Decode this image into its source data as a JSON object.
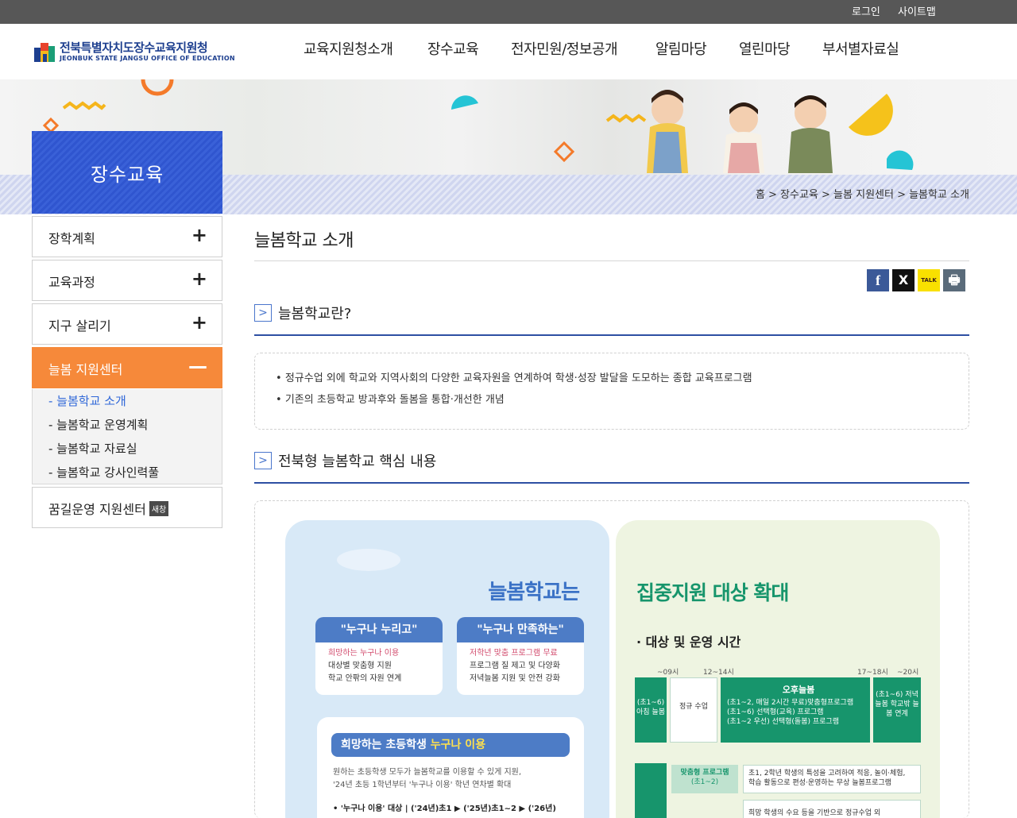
{
  "util": {
    "login": "로그인",
    "sitemap": "사이트맵"
  },
  "logo": {
    "ko": "전북특별자치도장수교육지원청",
    "en": "JEONBUK STATE JANGSU OFFICE OF EDUCATION"
  },
  "gnb": [
    "교육지원청소개",
    "장수교육",
    "전자민원/정보공개",
    "알림마당",
    "열린마당",
    "부서별자료실"
  ],
  "breadcrumb": "홈 > 장수교육 > 늘봄 지원센터 > 늘봄학교 소개",
  "sidebar": {
    "title": "장수교육",
    "items": [
      {
        "label": "장학계획",
        "toggle": "+"
      },
      {
        "label": "교육과정",
        "toggle": "+"
      },
      {
        "label": "지구 살리기",
        "toggle": "+"
      },
      {
        "label": "늘봄 지원센터",
        "toggle": "—"
      },
      {
        "label": "꿈길운영 지원센터",
        "badge": "새창"
      }
    ],
    "sub": [
      "- 늘봄학교 소개",
      "- 늘봄학교 운영계획",
      "- 늘봄학교 자료실",
      "- 늘봄학교 강사인력풀"
    ]
  },
  "page": {
    "title": "늘봄학교 소개"
  },
  "share": {
    "facebook": "f",
    "x": "X",
    "kakao": "TALK",
    "print": "🖶"
  },
  "sections": [
    {
      "title": "늘봄학교란?",
      "items": [
        "정규수업 외에 학교와 지역사회의 다양한 교육자원을 연계하여 학생·성장 발달을 도모하는 종합 교육프로그램",
        "기존의 초등학교 방과후와 돌봄을 통합·개선한 개념"
      ]
    },
    {
      "title": "전북형 늘봄학교 핵심 내용"
    }
  ],
  "infographic": {
    "left_title": "늘봄학교는",
    "card1": {
      "title": "\"누구나 누리고\"",
      "l1": "희망하는 누구나 이용",
      "l2": "대상별 맞춤형 지원",
      "l3": "학교 안팎의 자원 연계"
    },
    "card2": {
      "title": "\"누구나 만족하는\"",
      "l1": "저학년 맞춤 프로그램 무료",
      "l2": "프로그램 질 제고 및 다양화",
      "l3": "저녁늘봄 지원 및 안전 강화"
    },
    "wide": {
      "bar_a": "희망하는 초등학생 ",
      "bar_b": "누구나 이용",
      "t1": "원하는 초등학생 모두가 늘봄학교를 이용할 수 있게 지원,",
      "t2": "'24년 초등 1학년부터 '누구나 이용' 학년 연차별 확대",
      "t3": "• '누구나 이용' 대상 | ('24년)초1 ▶ ('25년)초1~2 ▶ ('26년)"
    },
    "right_title": "집중지원 대상 확대",
    "right_sub": "· 대상 및 운영 시간",
    "times": [
      "~09시",
      "12~14시",
      "17~18시",
      "~20시"
    ],
    "morning": "(초1~6) 아침 늘봄",
    "regular": "정규 수업",
    "afternoon": {
      "title": "오후늘봄",
      "l1": "(초1~2, 매일 2시간 무료)맞춤형프로그램",
      "l2": "(초1~6) 선택형(교육) 프로그램",
      "l3": "(초1~2 우선) 선택형(돌봄) 프로그램"
    },
    "evening": "(초1~6) 저녁늘봄 학교밖 늘봄 연계",
    "custom": {
      "title": "맞춤형 프로그램",
      "grade": "(초1~2)",
      "text1": "초1, 2학년 학생의 특성을 고려하여 적응, 놀이·체험,",
      "text2": "학습 활동으로 편성·운영하는 무상 늘봄프로그램"
    },
    "row2_text": "희망 학생의 수요 등을 기반으로 정규수업 외"
  },
  "colors": {
    "primary": "#2f55cf",
    "active": "#f6893a",
    "heading_line": "#2d4fa3",
    "topbar": "#575757",
    "green": "#17956c"
  }
}
